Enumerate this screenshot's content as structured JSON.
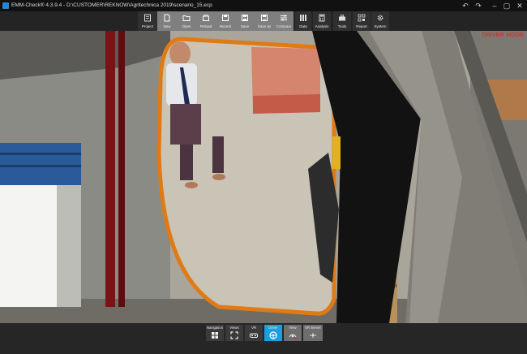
{
  "window": {
    "title": "EMM-Check® 4.3.9.4 - D:\\CUSTOMER\\REKNOW\\Agritechnica 2019\\scenario_15.ecp"
  },
  "toolbar": {
    "buttons": [
      {
        "label": "Project",
        "icon": "project-icon"
      },
      {
        "label": "New",
        "icon": "new-file-icon"
      },
      {
        "label": "Open",
        "icon": "folder-open-icon"
      },
      {
        "label": "Reload",
        "icon": "reload-icon"
      },
      {
        "label": "Recent",
        "icon": "recent-icon"
      },
      {
        "label": "Save",
        "icon": "save-icon"
      },
      {
        "label": "Save as",
        "icon": "save-as-icon"
      },
      {
        "label": "Compare",
        "icon": "compare-icon"
      },
      {
        "label": "Data",
        "icon": "data-icon"
      },
      {
        "label": "Analysis",
        "icon": "calculator-icon"
      },
      {
        "label": "Tools",
        "icon": "toolbox-icon"
      },
      {
        "label": "Report",
        "icon": "report-icon"
      },
      {
        "label": "System",
        "icon": "gear-icon"
      }
    ]
  },
  "viewport": {
    "mode_label": "DRIVER MODE"
  },
  "bottom_nav": {
    "buttons": [
      {
        "label": "Navigation",
        "icon": "grid-icon",
        "active": false
      },
      {
        "label": "Views",
        "icon": "fullscreen-icon",
        "active": false
      },
      {
        "label": "VR",
        "icon": "vr-headset-icon",
        "active": false
      },
      {
        "label": "Driver",
        "icon": "steering-wheel-icon",
        "active": true
      },
      {
        "label": "View",
        "icon": "view-icon",
        "active": false
      },
      {
        "label": "VR Server",
        "icon": "server-icon",
        "active": false
      }
    ]
  },
  "colors": {
    "accent": "#1aa0e0",
    "mode_label": "#d0281e",
    "mirror_frame": "#e07a14"
  }
}
